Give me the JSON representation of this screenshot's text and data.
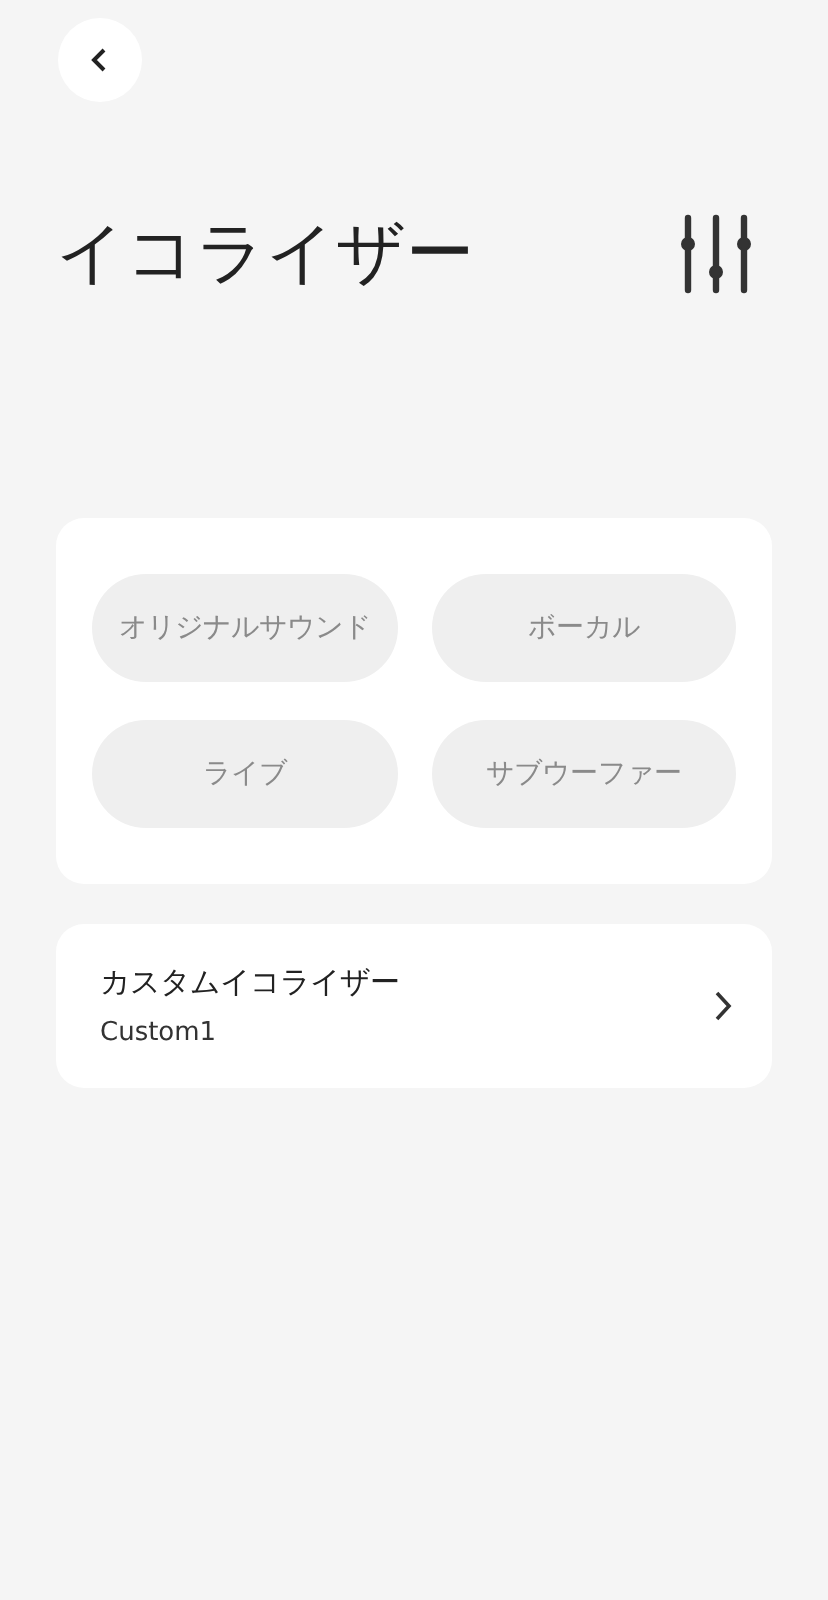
{
  "title": "イコライザー",
  "presets": [
    {
      "label": "オリジナルサウンド",
      "selected": false
    },
    {
      "label": "ボーカル",
      "selected": false
    },
    {
      "label": "ライブ",
      "selected": false
    },
    {
      "label": "サブウーファー",
      "selected": false
    }
  ],
  "custom": {
    "title": "カスタムイコライザー",
    "value": "Custom1"
  }
}
